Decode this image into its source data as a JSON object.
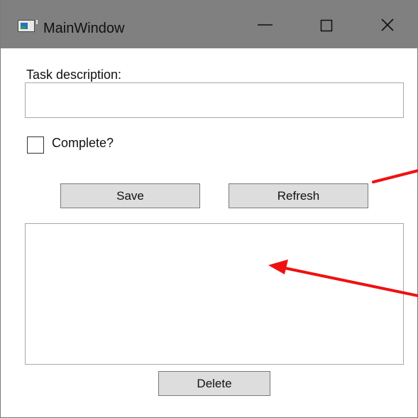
{
  "window": {
    "title": "MainWindow",
    "controls": [
      "minimize-icon",
      "maximize-icon",
      "close-icon"
    ],
    "titlebar_color": "#808080"
  },
  "form": {
    "task_label": "Task description:",
    "task_value": "",
    "complete_label": "Complete?",
    "complete_checked": false
  },
  "buttons": {
    "save": "Save",
    "refresh": "Refresh",
    "delete": "Delete"
  },
  "list": {
    "items": []
  },
  "annotations": {
    "color": "#ee1111",
    "icons": [
      "red-arrow-icon",
      "red-arrow-icon"
    ]
  }
}
